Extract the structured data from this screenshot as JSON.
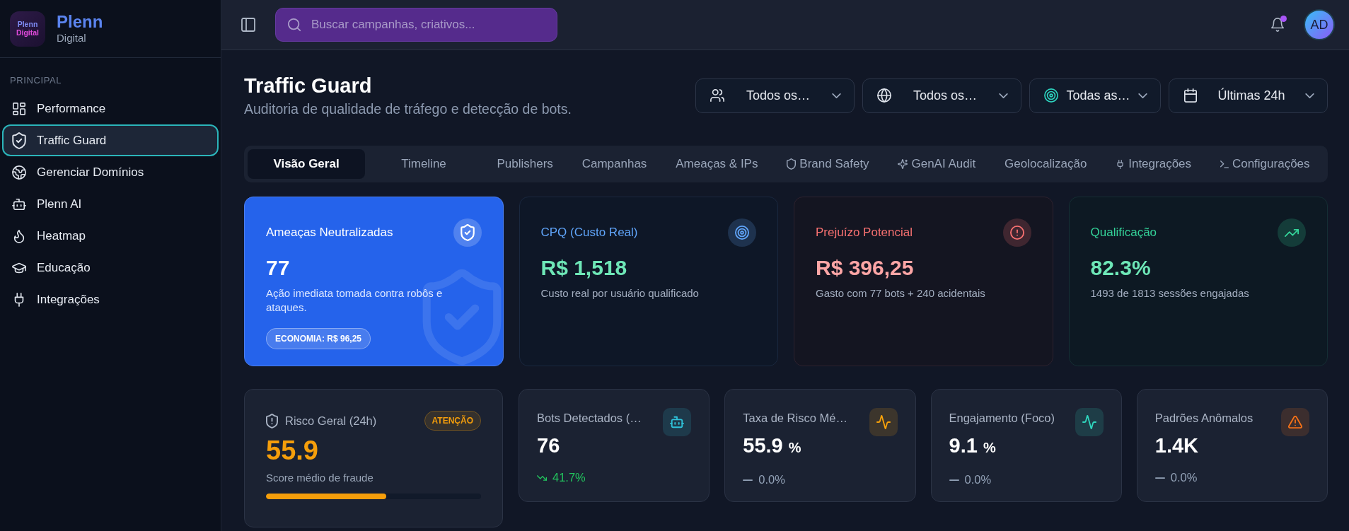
{
  "sidebar": {
    "logo": {
      "tile_lines": [
        "Plenn",
        "Digital"
      ],
      "name": "Plenn",
      "tagline": "Digital"
    },
    "section": "PRINCIPAL",
    "items": [
      {
        "label": "Performance",
        "selected": false
      },
      {
        "label": "Traffic Guard",
        "selected": true
      },
      {
        "label": "Gerenciar Domínios",
        "selected": false
      },
      {
        "label": "Plenn AI",
        "selected": false
      },
      {
        "label": "Heatmap",
        "selected": false
      },
      {
        "label": "Educação",
        "selected": false
      },
      {
        "label": "Integrações",
        "selected": false
      }
    ]
  },
  "topbar": {
    "search": {
      "placeholder": "Buscar campanhas, criativos..."
    },
    "notifications": {
      "unread": true
    },
    "avatar": {
      "initials": "AD"
    }
  },
  "header": {
    "title": "Traffic Guard",
    "subtitle": "Auditoria de qualidade de tráfego e detecção de bots.",
    "filters": [
      {
        "label": "Todos os…"
      },
      {
        "label": "Todos os…"
      },
      {
        "label": "Todas as…"
      },
      {
        "label": "Últimas 24h"
      }
    ]
  },
  "tabs": [
    {
      "label": "Visão Geral",
      "selected": true
    },
    {
      "label": "Timeline",
      "selected": false
    },
    {
      "label": "Publishers",
      "selected": false
    },
    {
      "label": "Campanhas",
      "selected": false
    },
    {
      "label": "Ameaças & IPs",
      "selected": false
    },
    {
      "label": "Brand Safety",
      "selected": false
    },
    {
      "label": "GenAI Audit",
      "selected": false
    },
    {
      "label": "Geolocalização",
      "selected": false
    },
    {
      "label": "Integrações",
      "selected": false
    },
    {
      "label": "Configurações",
      "selected": false
    }
  ],
  "summary_cards": [
    {
      "kind": "featured",
      "color": "#2563eb",
      "title": "Ameaças Neutralizadas",
      "value": {
        "text": "77",
        "color": "#ffffff"
      },
      "description": "Ação imediata tomada contra robôs e ataques.",
      "badge": "ECONOMIA: R$ 96,25"
    },
    {
      "kind": "metric",
      "color": "#60a5fa",
      "title": "CPQ (Custo Real)",
      "value": {
        "text": "R$ 1,518",
        "color": "#6ee7b7"
      },
      "description": "Custo real por usuário qualificado"
    },
    {
      "kind": "metric",
      "color": "#f87171",
      "title": "Prejuízo Potencial",
      "value": {
        "text": "R$ 396,25",
        "color": "#fca5a5"
      },
      "description": "Gasto com 77 bots + 240 acidentais"
    },
    {
      "kind": "metric",
      "color": "#34d399",
      "title": "Qualificação",
      "value": {
        "text": "82.3%",
        "color": "#6ee7b7"
      },
      "description": "1493 de 1813 sessões engajadas"
    }
  ],
  "stat_cards": [
    {
      "kind": "risk",
      "color": "#f59e0b",
      "title": "Risco Geral (24h)",
      "badge": "ATENÇÃO",
      "value": "55.9",
      "caption": "Score médio de fraude",
      "level": 0.559
    },
    {
      "kind": "stat",
      "color": "#1e3a4b",
      "title": "Bots Detectados (…",
      "value": "76",
      "change": {
        "kind": "down",
        "text": "41.7%"
      }
    },
    {
      "kind": "stat",
      "color": "#3c352c",
      "title": "Taxa de Risco Mé…",
      "value": "55.9",
      "unit": "%",
      "change": {
        "kind": "flat",
        "text": "0.0%"
      }
    },
    {
      "kind": "stat",
      "color": "#1e3d47",
      "title": "Engajamento (Foco)",
      "value": "9.1",
      "unit": "%",
      "change": {
        "kind": "flat",
        "text": "0.0%"
      }
    },
    {
      "kind": "stat",
      "color": "#3c2e2e",
      "title": "Padrões Anômalos",
      "value": "1.4K",
      "change": {
        "kind": "flat",
        "text": "0.0%"
      }
    }
  ]
}
